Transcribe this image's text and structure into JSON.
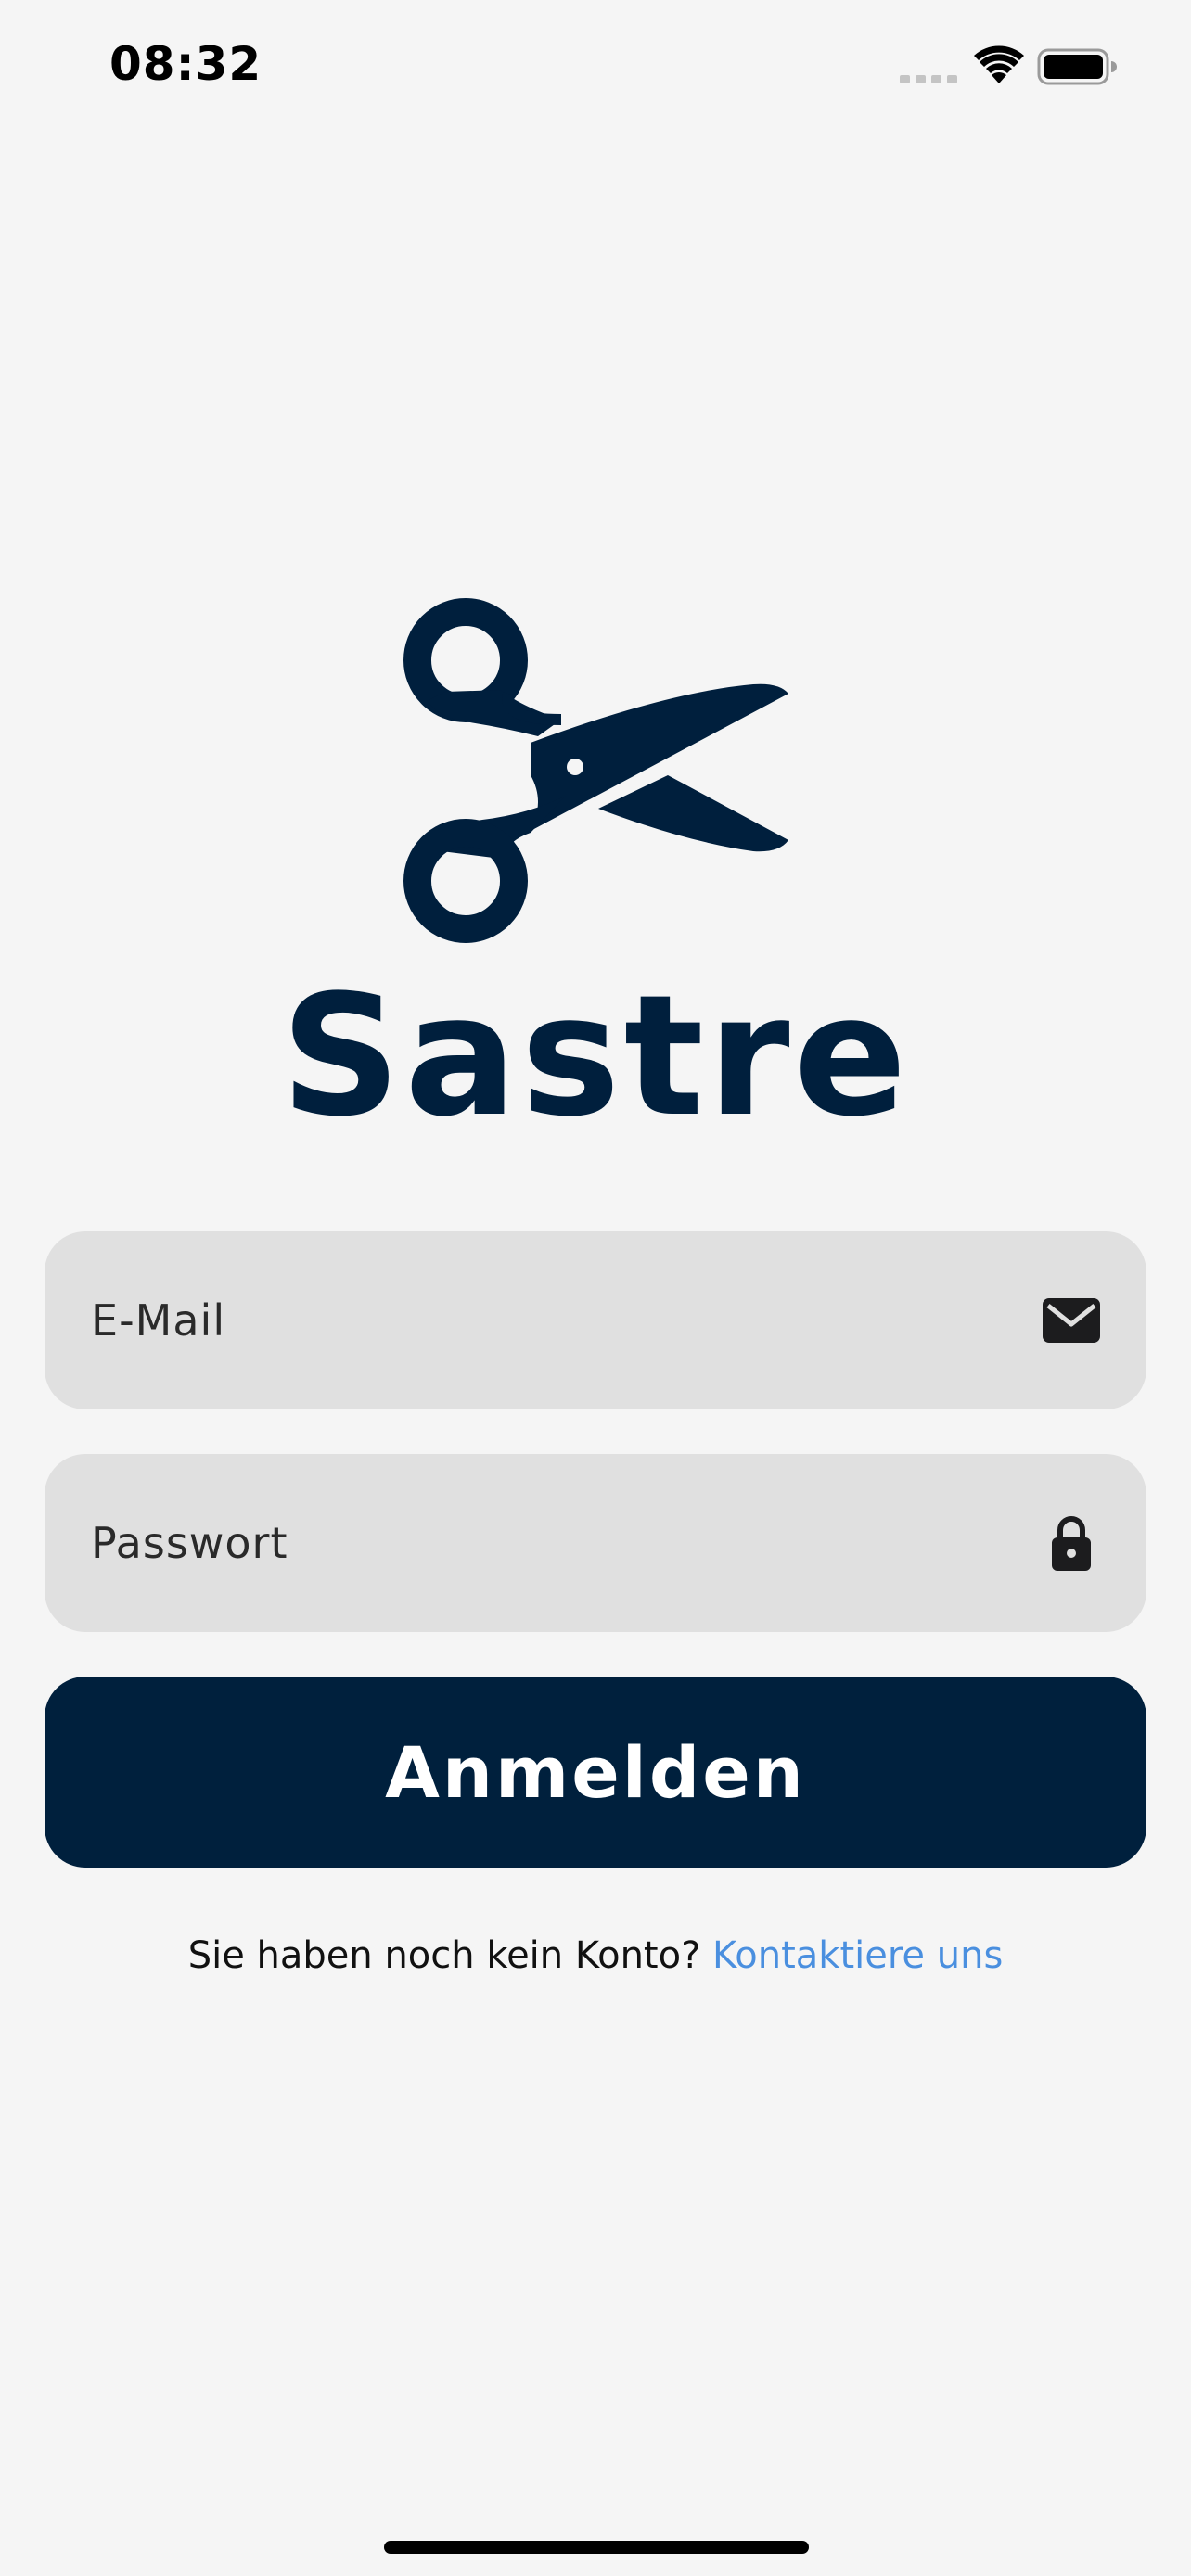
{
  "status_bar": {
    "time": "08:32"
  },
  "brand": {
    "name": "Sastre",
    "logo_icon": "scissors-icon",
    "color": "#001f3d"
  },
  "form": {
    "email_placeholder": "E-Mail",
    "email_value": "",
    "email_icon": "mail-icon",
    "password_placeholder": "Passwort",
    "password_value": "",
    "password_icon": "lock-icon",
    "submit_label": "Anmelden",
    "submit_color": "#00203d"
  },
  "signup": {
    "prompt": "Sie haben noch kein Konto? ",
    "link_label": "Kontaktiere uns",
    "link_color": "#4a8fdf"
  }
}
